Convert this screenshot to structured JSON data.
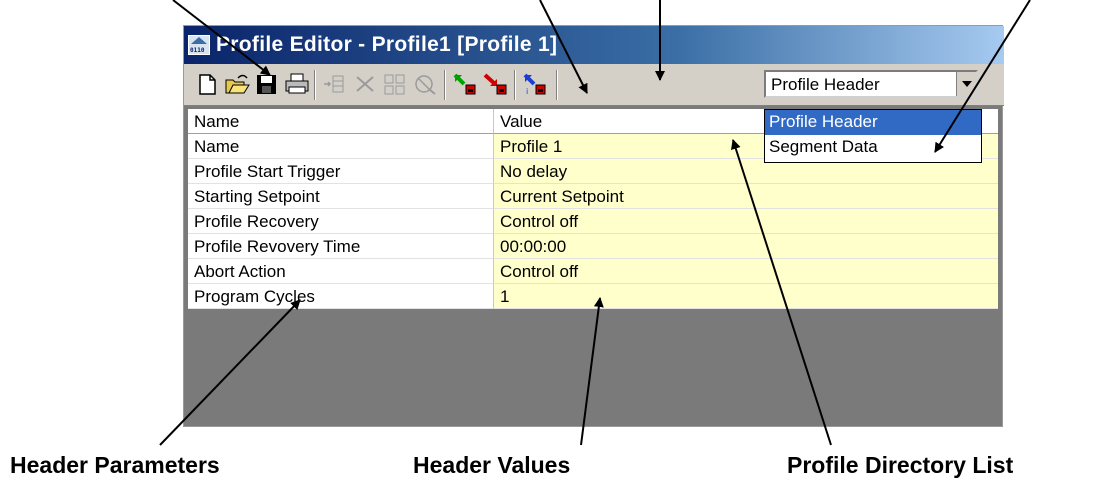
{
  "window": {
    "title": "Profile Editor - Profile1 [Profile 1]"
  },
  "toolbar": {
    "buttons": [
      "new-file-icon",
      "open-folder-icon",
      "save-disk-icon",
      "print-icon",
      "insert-segment-icon",
      "delete-segment-icon",
      "copy-segment-icon",
      "clear-segment-icon",
      "download-icon",
      "upload-icon",
      "profile-directory-icon"
    ],
    "view_select": {
      "selected": "Profile Header",
      "options": [
        "Profile Header",
        "Segment Data"
      ]
    }
  },
  "grid": {
    "columns": [
      "Name",
      "Value"
    ],
    "rows": [
      {
        "name": "Name",
        "value": "Profile 1"
      },
      {
        "name": "Profile Start Trigger",
        "value": "No delay"
      },
      {
        "name": "Starting Setpoint",
        "value": "Current Setpoint"
      },
      {
        "name": "Profile Recovery",
        "value": "Control off"
      },
      {
        "name": "Profile Revovery Time",
        "value": "00:00:00"
      },
      {
        "name": "Abort Action",
        "value": "Control off"
      },
      {
        "name": "Program Cycles",
        "value": "1"
      }
    ]
  },
  "callouts": {
    "header_parameters": "Header Parameters",
    "header_values": "Header Values",
    "profile_directory_list": "Profile Directory List"
  },
  "colors": {
    "value_bg": "#ffffcc",
    "title_start": "#0a246a",
    "selection": "#316ac5"
  }
}
